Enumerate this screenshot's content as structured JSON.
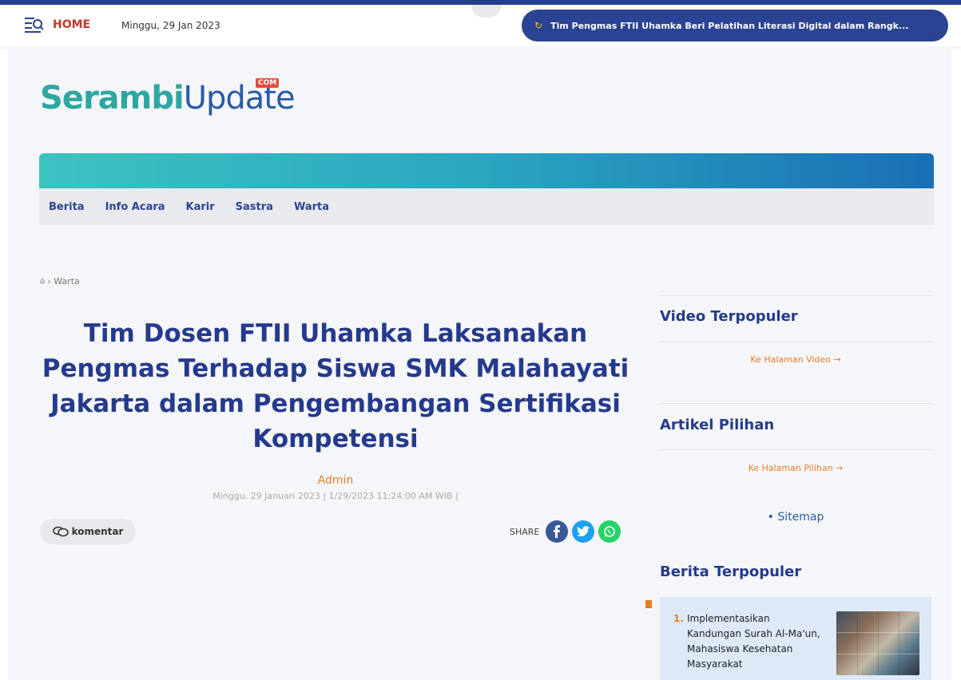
{
  "topbar": {
    "home_label": "HOME",
    "date": "Minggu, 29 Jan 2023",
    "ticker_text": "Tim Pengmas FTII Uhamka Beri Pelatihan Literasi Digital dalam Rangk..."
  },
  "logo": {
    "part1": "Serambi",
    "part2": "Update",
    "suffix": "COM"
  },
  "nav": [
    "Berita",
    "Info Acara",
    "Karir",
    "Sastra",
    "Warta"
  ],
  "breadcrumb": {
    "current": "Warta"
  },
  "article": {
    "title": "Tim Dosen FTII Uhamka Laksanakan Pengmas Terhadap Siswa SMK Malahayati Jakarta dalam Pengembangan Sertifikasi Kompetensi",
    "author": "Admin",
    "meta": "Minggu, 29 Januari 2023 | 1/29/2023 11:24:00 AM WIB |",
    "comment_label": "komentar",
    "share_label": "SHARE"
  },
  "sidebar": {
    "video_heading": "Video Terpopuler",
    "video_link": "Ke Halaman Video →",
    "pilihan_heading": "Artikel Pilihan",
    "pilihan_link": "Ke Halaman Pilihan →",
    "sitemap": "• Sitemap",
    "berita_heading": "Berita Terpopuler",
    "popular": [
      {
        "num": "1.",
        "title": "Implementasikan Kandungan Surah Al-Ma'un, Mahasiswa Kesehatan Masyarakat"
      }
    ]
  },
  "colors": {
    "brand_blue": "#253a8c",
    "accent_orange": "#e67e22",
    "teal": "#2ea7a2"
  }
}
